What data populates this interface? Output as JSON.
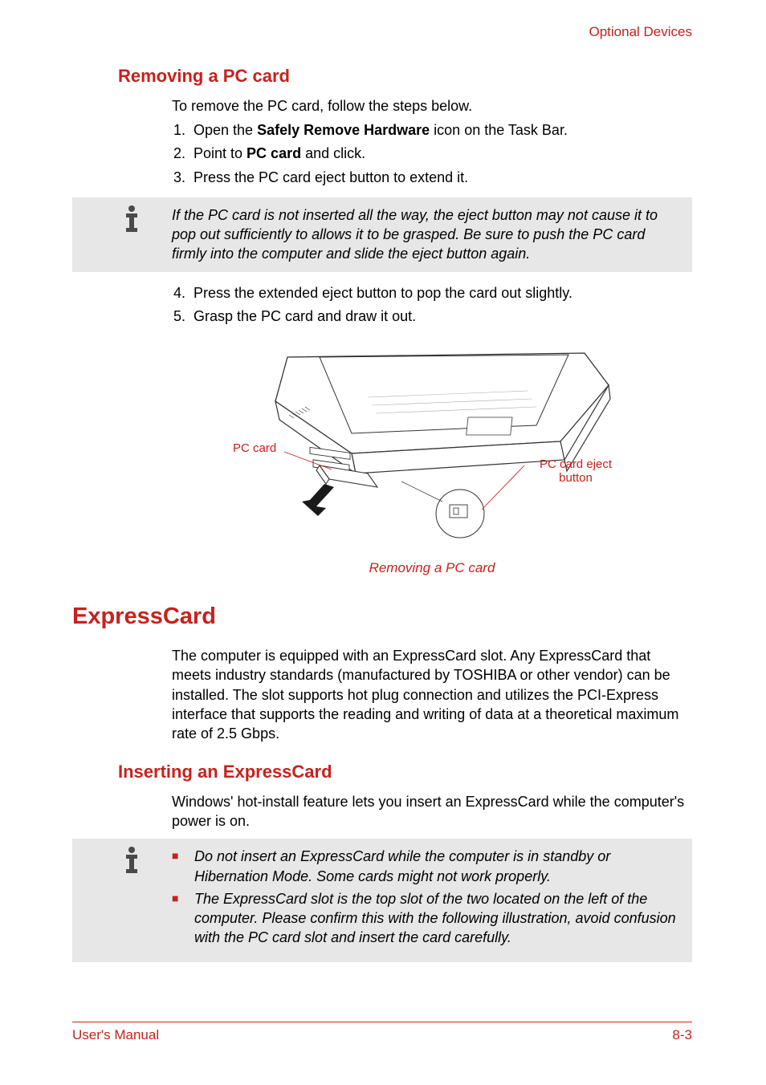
{
  "header": {
    "section": "Optional Devices"
  },
  "removing": {
    "title": "Removing a PC card",
    "intro": "To remove the PC card, follow the steps below.",
    "steps1": [
      {
        "pre": "Open the ",
        "bold": "Safely Remove Hardware",
        "post": " icon on the Task Bar."
      },
      {
        "pre": "Point to ",
        "bold": "PC card",
        "post": " and click."
      },
      {
        "pre": "Press the PC card eject button to extend it.",
        "bold": "",
        "post": ""
      }
    ],
    "note": "If the PC card is not inserted all the way, the eject button may not cause it to pop out sufficiently to allows it to be grasped. Be sure to push the PC card firmly into the computer and slide the eject button again.",
    "steps2": [
      "Press the extended eject button to pop the card out slightly.",
      "Grasp the PC card and draw it out."
    ],
    "figure": {
      "label_left": "PC card",
      "label_right": "PC card eject button",
      "caption": "Removing a PC card"
    }
  },
  "express": {
    "title": "ExpressCard",
    "body": "The computer is equipped with an ExpressCard slot. Any ExpressCard that meets industry standards (manufactured by TOSHIBA or other vendor) can be installed. The slot supports hot plug connection and utilizes the PCI-Express interface that supports the reading and writing of data at a theoretical maximum rate of 2.5 Gbps."
  },
  "inserting": {
    "title": "Inserting an ExpressCard",
    "body": "Windows' hot-install feature lets you insert an ExpressCard while the computer's power is on.",
    "notes": [
      "Do not insert an ExpressCard while the computer is in standby or Hibernation Mode. Some cards might not work properly.",
      "The ExpressCard slot is the top slot of the two located on the left of the computer. Please confirm this with the following illustration, avoid confusion with the PC card slot and insert the card carefully."
    ]
  },
  "footer": {
    "left": "User's Manual",
    "right": "8-3"
  }
}
